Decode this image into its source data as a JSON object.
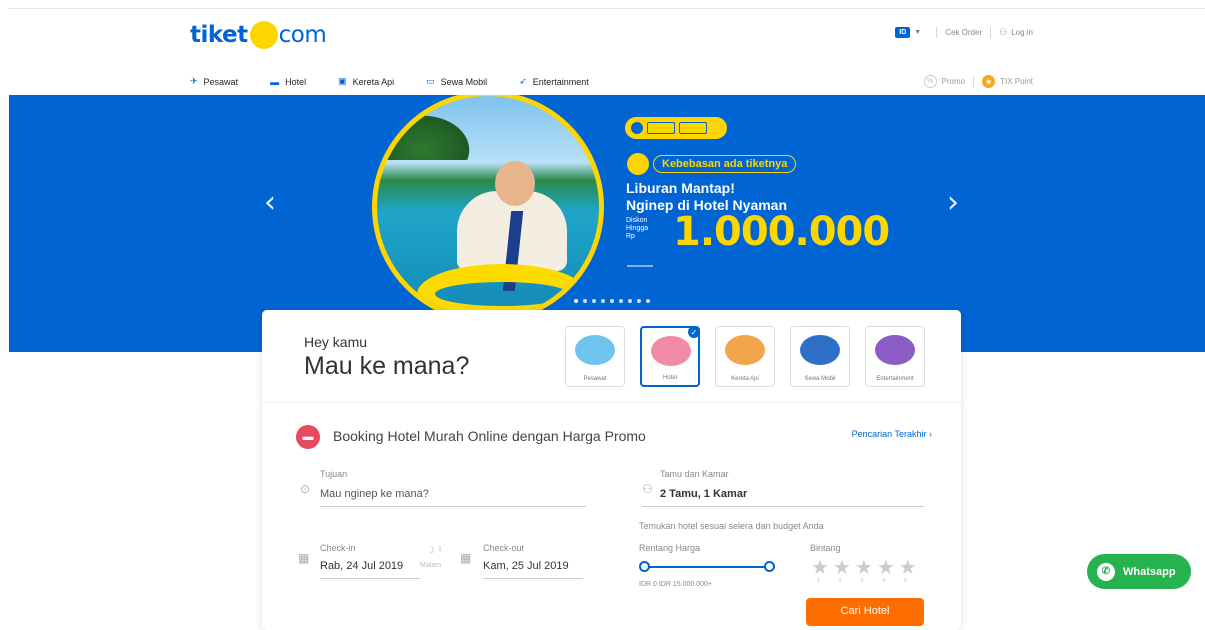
{
  "header": {
    "logo_left": "tiket",
    "logo_right": "com",
    "lang": "ID",
    "cek_order": "Cek Order",
    "login": "Log in",
    "promo": "Promo",
    "points": "TIX Point"
  },
  "nav": [
    {
      "label": "Pesawat",
      "icon": "plane-icon"
    },
    {
      "label": "Hotel",
      "icon": "bed-icon"
    },
    {
      "label": "Kereta Api",
      "icon": "train-icon"
    },
    {
      "label": "Sewa Mobil",
      "icon": "car-icon"
    },
    {
      "label": "Entertainment",
      "icon": "rocket-icon"
    }
  ],
  "banner": {
    "tagline": "Kebebasan ada tiketnya",
    "title_line1": "Liburan Mantap!",
    "title_line2": "Nginep di Hotel Nyaman",
    "diskon_1": "Diskon",
    "diskon_2": "Hingga",
    "diskon_3": "Rp",
    "amount": "1.000.000",
    "slide_count": 9,
    "active_slide": 0
  },
  "search_card": {
    "greeting": "Hey kamu",
    "question": "Mau ke mana?",
    "products": [
      {
        "label": "Pesawat",
        "selected": false,
        "color": "#6fc3ee"
      },
      {
        "label": "Hotel",
        "selected": true,
        "color": "#f08aa8"
      },
      {
        "label": "Kereta Api",
        "selected": false,
        "color": "#f3a54b"
      },
      {
        "label": "Sewa Mobil",
        "selected": false,
        "color": "#2e6fc7"
      },
      {
        "label": "Entertainment",
        "selected": false,
        "color": "#8b5cc5"
      }
    ],
    "section_title": "Booking Hotel Murah Online dengan Harga Promo",
    "recent_search": "Pencarian Terakhir",
    "destination_label": "Tujuan",
    "destination_placeholder": "Mau nginep ke mana?",
    "guest_label": "Tamu dan Kamar",
    "guest_value": "2 Tamu, 1 Kamar",
    "checkin_label": "Check-in",
    "checkin_value": "Rab, 24 Jul 2019",
    "nights_value": "1",
    "nights_label": "Malam",
    "checkout_label": "Check-out",
    "checkout_value": "Kam, 25 Jul 2019",
    "filter_hint": "Temukan hotel sesuai selera dan budget Anda",
    "price_label": "Rentang Harga",
    "price_range": "IDR 0 IDR 15.000.000+",
    "rating_label": "Bintang",
    "star_numbers": [
      "1",
      "2",
      "3",
      "4",
      "5"
    ],
    "cta_label": "Cari Hotel"
  },
  "whatsapp": {
    "label": "Whatsapp"
  },
  "colors": {
    "brand_blue": "#0064d2",
    "brand_yellow": "#fdd600",
    "cta_orange": "#ff6d00",
    "whatsapp_green": "#25b24f"
  }
}
